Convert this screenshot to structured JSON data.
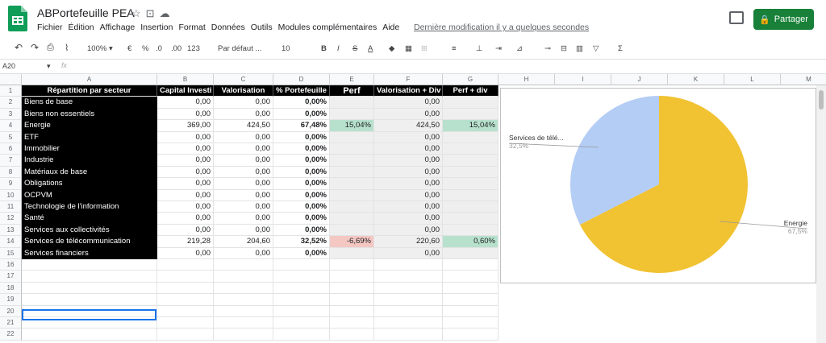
{
  "app": {
    "title": "ABPortefeuille PEA",
    "menu": [
      "Fichier",
      "Édition",
      "Affichage",
      "Insertion",
      "Format",
      "Données",
      "Outils",
      "Modules complémentaires",
      "Aide"
    ],
    "last_modified": "Dernière modification il y a quelques secondes",
    "share_label": "Partager"
  },
  "toolbar": {
    "zoom": "100%",
    "currency": "€",
    "percent": "%",
    "dec_less": ".0",
    "dec_more": ".00",
    "number_format": "123",
    "font": "Par défaut ...",
    "font_size": "10",
    "bold": "B",
    "italic": "I",
    "strike": "S",
    "text_color": "A",
    "sum": "Σ"
  },
  "formula_bar": {
    "cell_ref": "A20",
    "fx": "fx",
    "value": ""
  },
  "columns": [
    "A",
    "B",
    "C",
    "D",
    "E",
    "F",
    "G",
    "H",
    "I",
    "J",
    "K",
    "L",
    "M"
  ],
  "table": {
    "headers": [
      "Répartition par secteur",
      "Capital Investi",
      "Valorisation",
      "% Portefeuille",
      "Perf",
      "Valorisation + Div",
      "Perf + div"
    ],
    "rows": [
      [
        "Biens de base",
        "0,00",
        "0,00",
        "0,00%",
        "",
        "0,00",
        ""
      ],
      [
        "Biens non essentiels",
        "0,00",
        "0,00",
        "0,00%",
        "",
        "0,00",
        ""
      ],
      [
        "Energie",
        "369,00",
        "424,50",
        "67,48%",
        "15,04%",
        "424,50",
        "15,04%"
      ],
      [
        "ETF",
        "0,00",
        "0,00",
        "0,00%",
        "",
        "0,00",
        ""
      ],
      [
        "Immobilier",
        "0,00",
        "0,00",
        "0,00%",
        "",
        "0,00",
        ""
      ],
      [
        "Industrie",
        "0,00",
        "0,00",
        "0,00%",
        "",
        "0,00",
        ""
      ],
      [
        "Matériaux de base",
        "0,00",
        "0,00",
        "0,00%",
        "",
        "0,00",
        ""
      ],
      [
        "Obligations",
        "0,00",
        "0,00",
        "0,00%",
        "",
        "0,00",
        ""
      ],
      [
        "OCPVM",
        "0,00",
        "0,00",
        "0,00%",
        "",
        "0,00",
        ""
      ],
      [
        "Technologie de l'information",
        "0,00",
        "0,00",
        "0,00%",
        "",
        "0,00",
        ""
      ],
      [
        "Santé",
        "0,00",
        "0,00",
        "0,00%",
        "",
        "0,00",
        ""
      ],
      [
        "Services aux collectivités",
        "0,00",
        "0,00",
        "0,00%",
        "",
        "0,00",
        ""
      ],
      [
        "Services de télécommunication",
        "219,28",
        "204,60",
        "32,52%",
        "-6,69%",
        "220,60",
        "0,60%"
      ],
      [
        "Services financiers",
        "0,00",
        "0,00",
        "0,00%",
        "",
        "0,00",
        ""
      ]
    ]
  },
  "row_numbers": [
    "1",
    "2",
    "3",
    "4",
    "5",
    "6",
    "7",
    "8",
    "9",
    "10",
    "11",
    "12",
    "13",
    "14",
    "15",
    "16",
    "17",
    "18",
    "19",
    "20",
    "21",
    "22"
  ],
  "colors": {
    "accent": "#188038",
    "energie": "#f1c232",
    "telecom": "#b4cdf5",
    "positive": "#b7e1cd",
    "negative": "#f4c7c3",
    "selection": "#1a73e8"
  },
  "chart_data": {
    "type": "pie",
    "categories": [
      "Energie",
      "Services de télé..."
    ],
    "values": [
      67.5,
      32.5
    ],
    "value_labels": [
      "67,5%",
      "32,5%"
    ],
    "colors": [
      "#f1c232",
      "#b4cdf5"
    ]
  }
}
